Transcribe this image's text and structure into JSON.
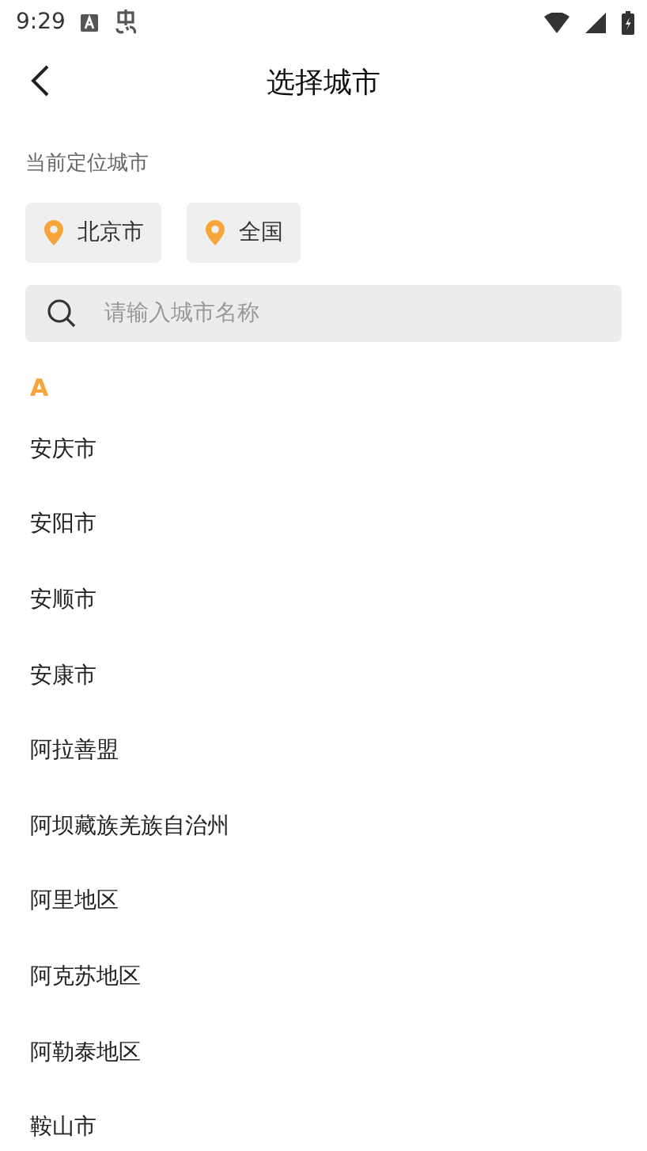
{
  "status_bar": {
    "time": "9:29"
  },
  "header": {
    "title": "选择城市"
  },
  "location": {
    "label": "当前定位城市",
    "chips": [
      "北京市",
      "全国"
    ]
  },
  "search": {
    "placeholder": "请输入城市名称"
  },
  "sections": [
    {
      "letter": "A",
      "cities": [
        "安庆市",
        "安阳市",
        "安顺市",
        "安康市",
        "阿拉善盟",
        "阿坝藏族羌族自治州",
        "阿里地区",
        "阿克苏地区",
        "阿勒泰地区",
        "鞍山市"
      ]
    }
  ]
}
